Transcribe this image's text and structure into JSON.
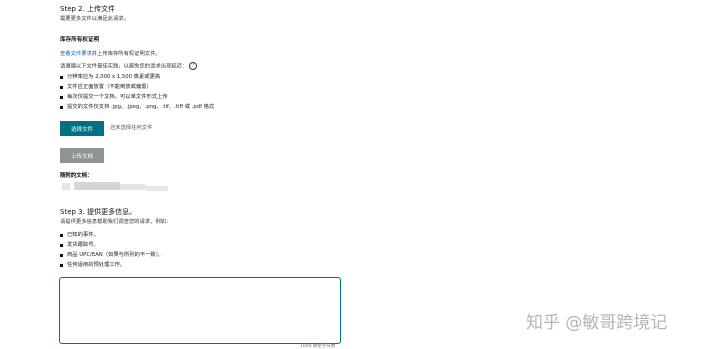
{
  "step2": {
    "title": "Step 2. 上传文件",
    "subtitle": "需要更多文件以满足此请求。"
  },
  "proof": {
    "heading": "库存所有权证明",
    "intro_link": "查看文件要求",
    "intro_rest": "并上传库存所有权证明文件。",
    "instruction": "请遵循以下文件最佳实践，以避免您的请求出现延迟：",
    "help_icon": "?",
    "bullets": [
      "分辨率应为 2,000 x 1,500 像素或更高",
      "文件应正面放置（不能倒放或偏置）",
      "每次仅提交一个文档，可以单文件形式上传",
      "提交的文件仅支持 .jpg、.jpeg、.png、.tif、.tiff 或 .pdf 格式"
    ]
  },
  "upload": {
    "choose_button": "选择文件",
    "no_file_text": "还未选择任何文件",
    "upload_button": "上传文档"
  },
  "attached": {
    "label": "随附的文档："
  },
  "step3": {
    "title": "Step 3. 提供更多信息。",
    "intro": "请提供更多信息帮助我们调查您的请求，例如：",
    "bullets": [
      "已知的事件。",
      "发货跟踪号。",
      "商品 UPC/EAN（如果与所列的不一致）。",
      "任何适用的预处理工作。"
    ],
    "textarea_value": "",
    "char_counter": "1000 剩余字符数"
  },
  "watermark": "知乎 @敏哥跨境记",
  "colors": {
    "primary": "#007185",
    "disabled": "#8d9494",
    "link": "#0066c0"
  }
}
